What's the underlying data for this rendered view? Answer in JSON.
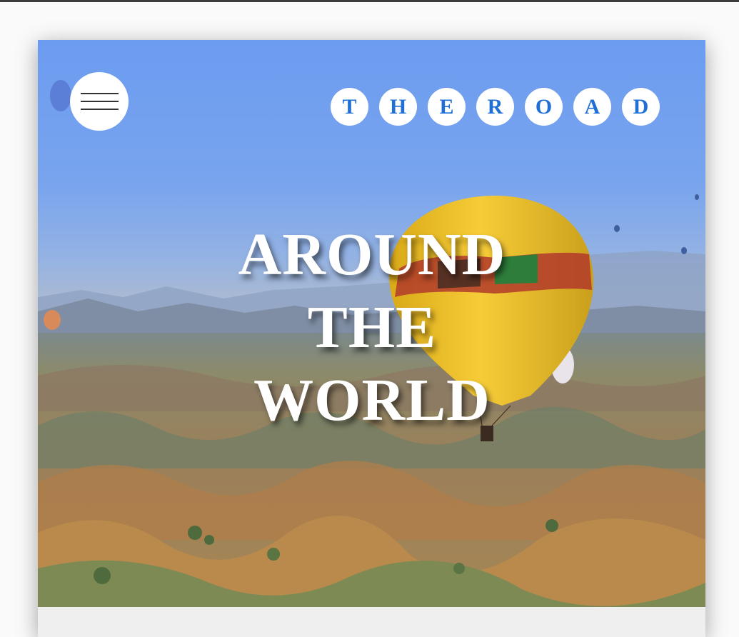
{
  "header": {
    "brand_letters": [
      "T",
      "H",
      "E",
      "R",
      "O",
      "A",
      "D"
    ],
    "menu_icon": "hamburger-menu-icon"
  },
  "hero": {
    "headline_lines": [
      "AROUND",
      "THE",
      "WORLD"
    ],
    "image": "hot-air-balloons-over-valley"
  },
  "colors": {
    "brand_letter": "#1f6fd6",
    "sky": "#6c9cf0",
    "balloon": "#f2c42b"
  }
}
